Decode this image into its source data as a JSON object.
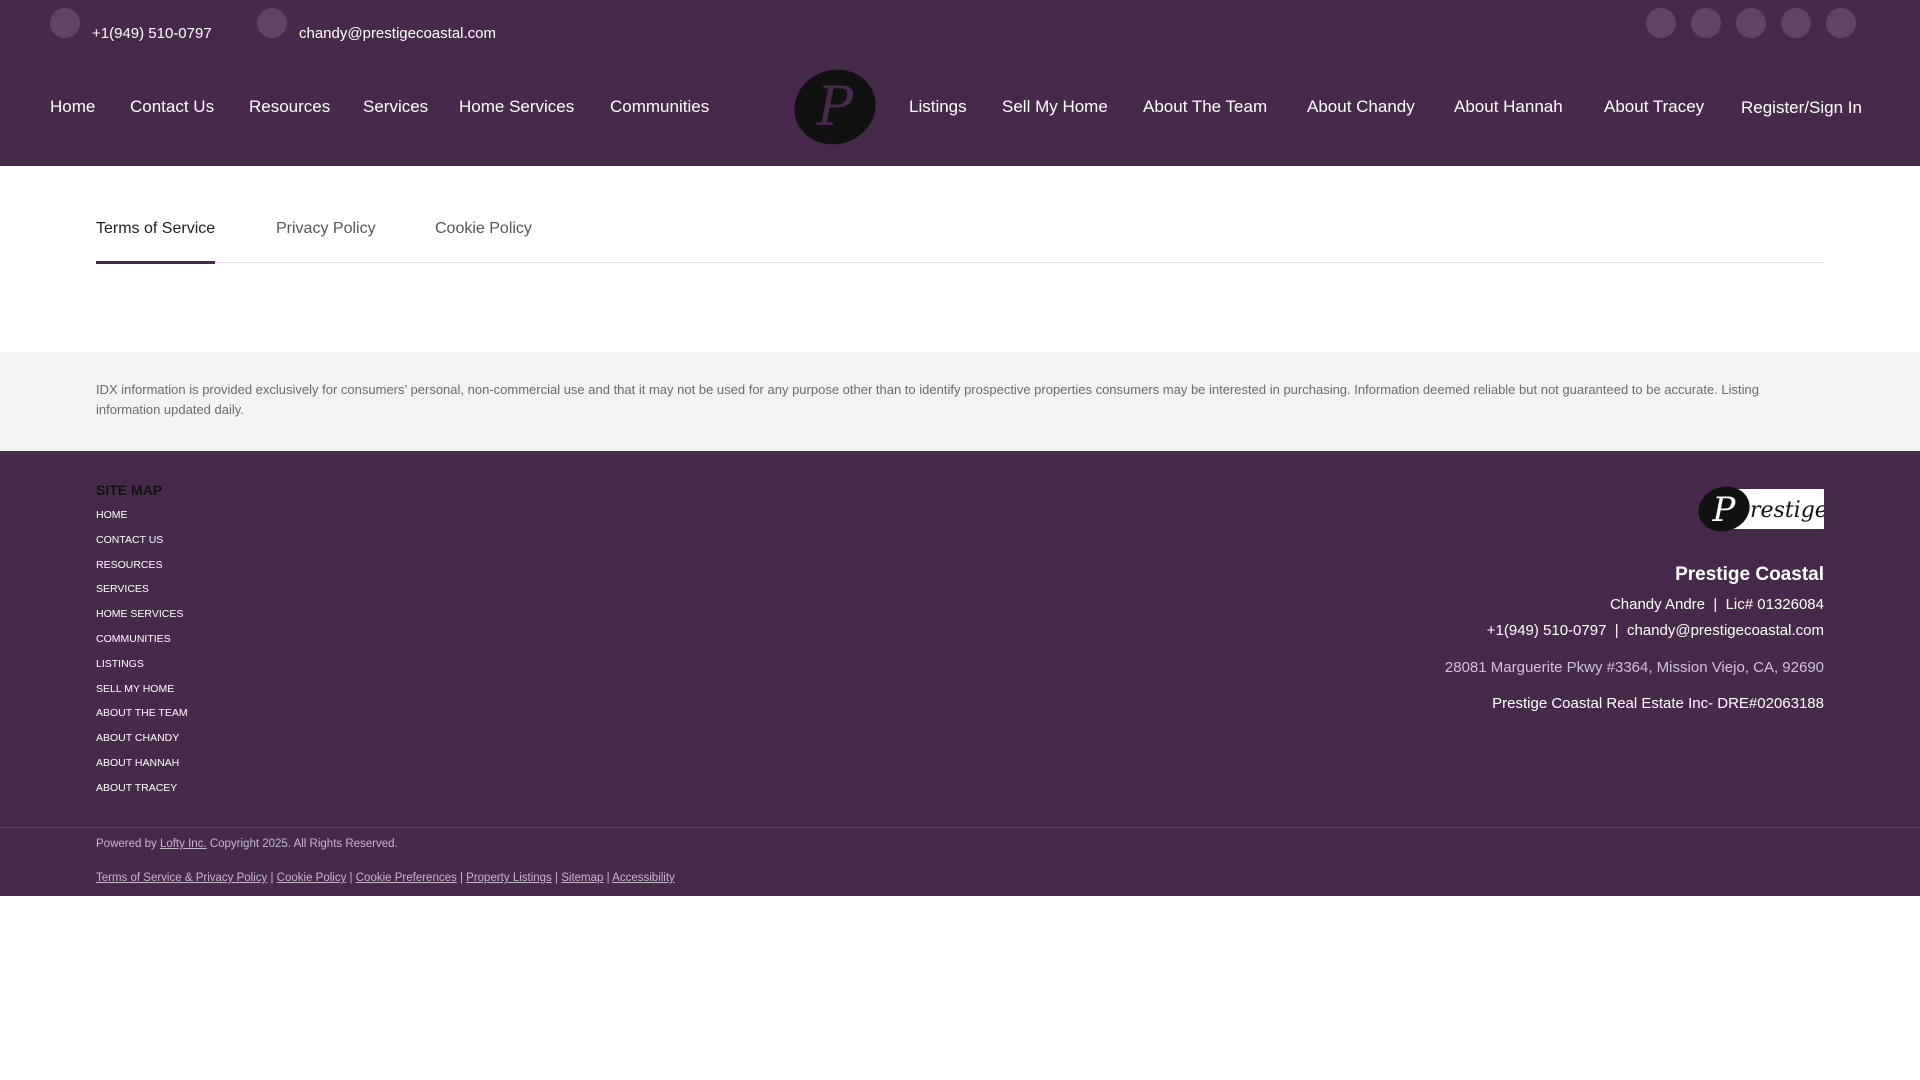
{
  "topbar": {
    "phone": "+1(949) 510-0797",
    "email": "chandy@prestigecoastal.com",
    "phone_icon": "phone-icon",
    "email_icon": "email-icon",
    "social_icons": [
      "social-icon-1",
      "social-icon-2",
      "social-icon-3",
      "social-icon-4",
      "social-icon-5"
    ]
  },
  "nav": {
    "left": [
      "Home",
      "Contact Us",
      "Resources",
      "Services",
      "Home Services",
      "Communities"
    ],
    "right": [
      "Listings",
      "Sell My Home",
      "About The Team",
      "About Chandy",
      "About Hannah",
      "About Tracey"
    ],
    "register": "Register/Sign In"
  },
  "tabs": [
    "Terms of Service",
    "Privacy Policy",
    "Cookie Policy"
  ],
  "disclaimer": "IDX information is provided exclusively for consumers’ personal, non-commercial use and that it may not be used for any purpose other than to identify prospective properties consumers may be interested in purchasing. Information deemed reliable but not guaranteed to be accurate. Listing information updated daily.",
  "footer": {
    "sitemap_title": "SITE MAP",
    "sitemap": [
      "HOME",
      "CONTACT US",
      "RESOURCES",
      "SERVICES",
      "HOME SERVICES",
      "COMMUNITIES",
      "LISTINGS",
      "SELL MY HOME",
      "ABOUT THE TEAM",
      "ABOUT CHANDY",
      "ABOUT HANNAH",
      "ABOUT TRACEY"
    ],
    "logo_text": "restige",
    "company": "Prestige Coastal",
    "agent_line": "Chandy Andre  |  Lic# 01326084",
    "contact_line": "+1(949) 510-0797  |  chandy@prestigecoastal.com",
    "address": "28081 Marguerite Pkwy #3364, Mission Viejo, CA, 92690",
    "dre": "Prestige Coastal Real Estate Inc- DRE#02063188",
    "powered_prefix": "Powered by",
    "powered_link": "Lofty Inc.",
    "copyright": "Copyright 2025. All Rights Reserved.",
    "legal_links": [
      "Terms of Service & Privacy Policy",
      "Cookie Policy",
      "Cookie Preferences",
      "Property Listings",
      "Sitemap",
      "Accessibility"
    ],
    "legal_separator": "|"
  },
  "colors": {
    "brand_purple": "#472a4b",
    "disclaimer_bg": "#f3f3f3"
  }
}
